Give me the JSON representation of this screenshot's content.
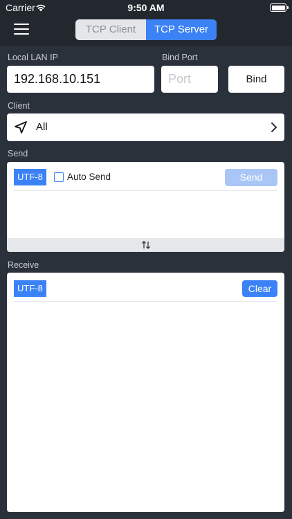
{
  "status_bar": {
    "carrier": "Carrier",
    "time": "9:50 AM"
  },
  "nav": {
    "segments": [
      {
        "label": "TCP Client",
        "selected": false
      },
      {
        "label": "TCP Server",
        "selected": true
      }
    ],
    "accent_color": "#3b82f6"
  },
  "config": {
    "ip_label": "Local LAN IP",
    "ip_value": "192.168.10.151",
    "port_label": "Bind Port",
    "port_placeholder": "Port",
    "bind_label": "Bind"
  },
  "client": {
    "label": "Client",
    "selected": "All",
    "icon": "send-arrow-icon"
  },
  "send": {
    "label": "Send",
    "encoding": "UTF-8",
    "auto_send_label": "Auto Send",
    "auto_send_checked": false,
    "send_button": "Send"
  },
  "receive": {
    "label": "Receive",
    "encoding": "UTF-8",
    "clear_button": "Clear"
  }
}
